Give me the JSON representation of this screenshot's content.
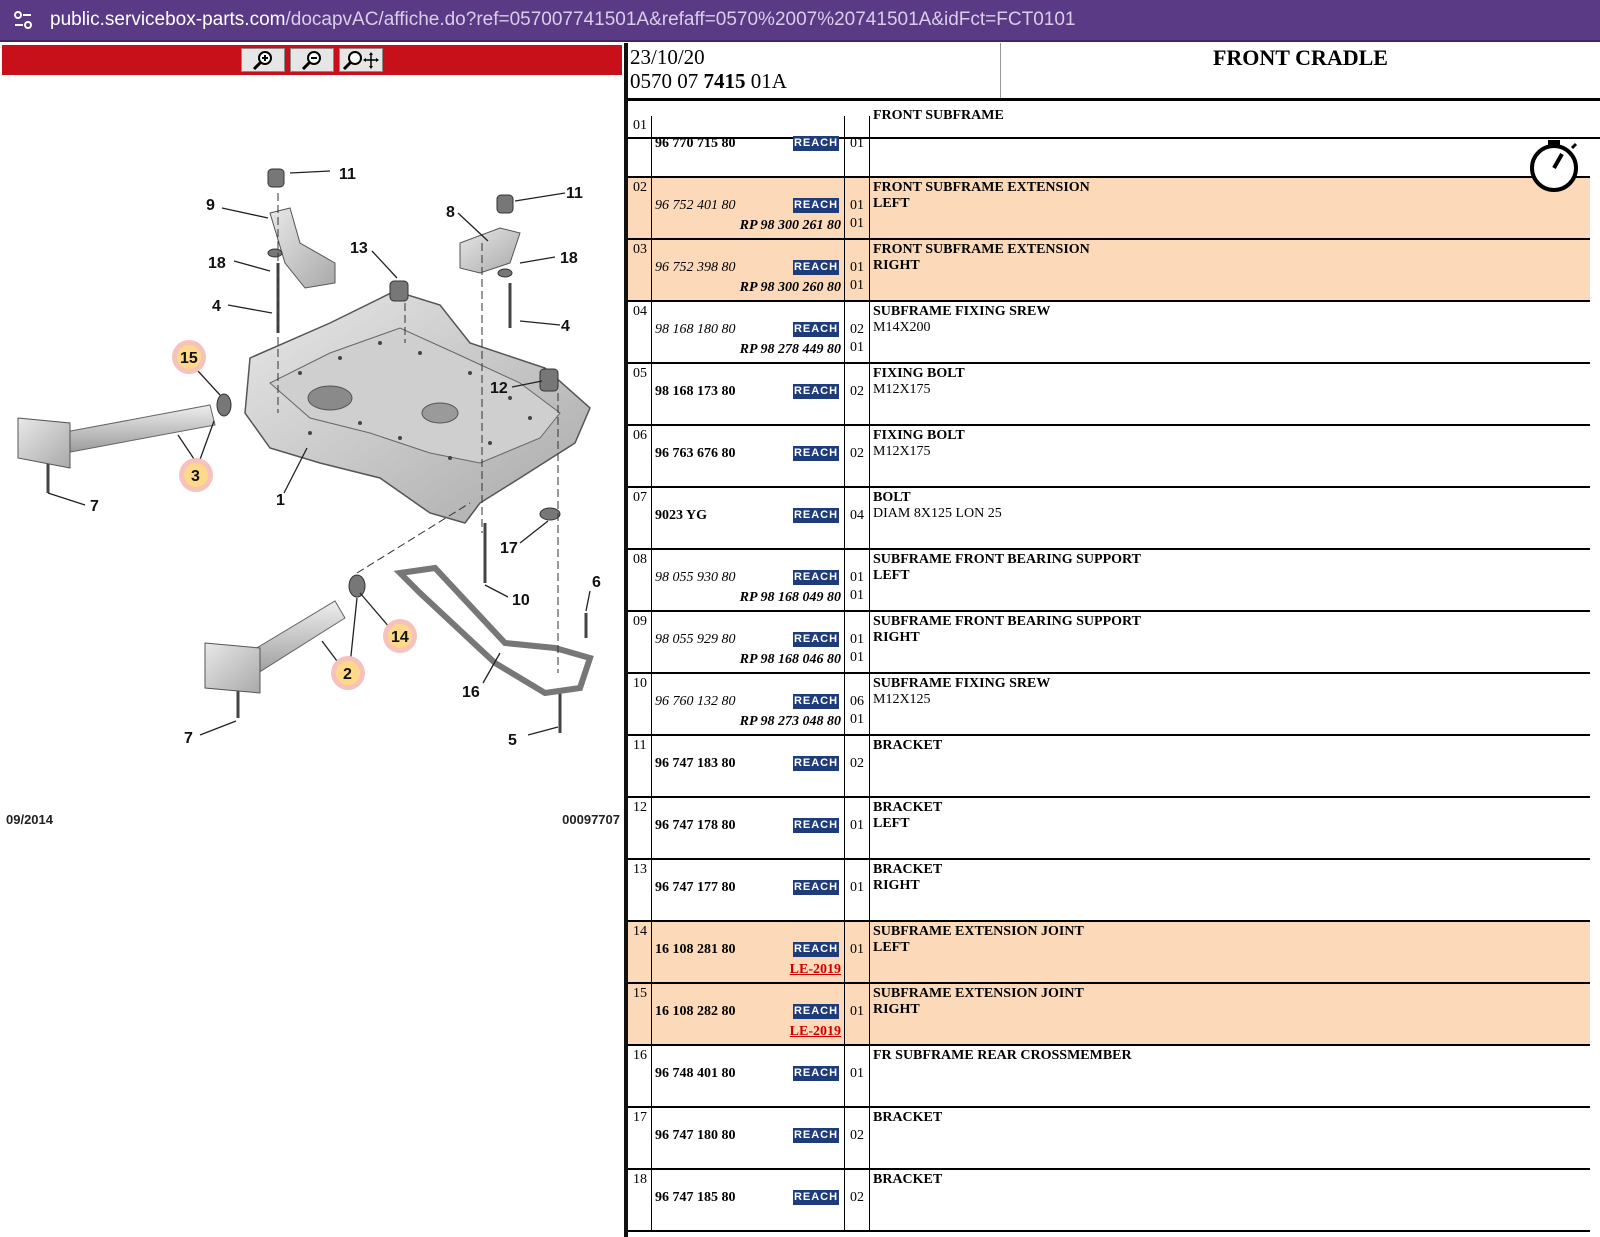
{
  "browser": {
    "url_host": "public.servicebox-parts.com",
    "url_path": "/docapvAC/affiche.do?ref=057007741501A&refaff=0570%2007%20741501A&idFct=FCT0101"
  },
  "viewer": {
    "tools": [
      {
        "name": "zoom-in-icon",
        "label": "zoom in"
      },
      {
        "name": "zoom-out-icon",
        "label": "zoom out"
      },
      {
        "name": "zoom-pan-icon",
        "label": "zoom pan"
      }
    ],
    "footer_date": "09/2014",
    "footer_ref": "00097707",
    "callouts": [
      "1",
      "2",
      "3",
      "4",
      "4",
      "5",
      "6",
      "7",
      "7",
      "8",
      "9",
      "10",
      "11",
      "11",
      "12",
      "13",
      "14",
      "15",
      "16",
      "17",
      "18",
      "18"
    ],
    "highlighted_callouts": [
      "15",
      "3",
      "14",
      "2"
    ]
  },
  "header": {
    "date": "23/10/20",
    "ref_prefix": "0570 07 ",
    "ref_bold": "7415",
    "ref_suffix": " 01A",
    "title": "FRONT CRADLE"
  },
  "reach_label": "REACH",
  "parts": [
    {
      "idx": "01",
      "ref": "96 770 715 80",
      "italic": false,
      "qty": "01",
      "qty2": "",
      "rp": "",
      "le": "",
      "desc": "FRONT SUBFRAME",
      "desc2": "",
      "highlight": false,
      "partial": true
    },
    {
      "idx": "02",
      "ref": "96 752 401 80",
      "italic": true,
      "qty": "01",
      "qty2": "01",
      "rp": "RP 98 300 261 80",
      "le": "",
      "desc": "FRONT SUBFRAME EXTENSION",
      "desc2": "LEFT",
      "desc2_bold": true,
      "highlight": true
    },
    {
      "idx": "03",
      "ref": "96 752 398 80",
      "italic": true,
      "qty": "01",
      "qty2": "01",
      "rp": "RP 98 300 260 80",
      "le": "",
      "desc": "FRONT SUBFRAME EXTENSION",
      "desc2": "RIGHT",
      "desc2_bold": true,
      "highlight": true
    },
    {
      "idx": "04",
      "ref": "98 168 180 80",
      "italic": true,
      "qty": "02",
      "qty2": "01",
      "rp": "RP 98 278 449 80",
      "le": "",
      "desc": "SUBFRAME FIXING SREW",
      "desc2": "M14X200",
      "desc2_bold": false,
      "highlight": false
    },
    {
      "idx": "05",
      "ref": "98 168 173 80",
      "italic": false,
      "qty": "02",
      "qty2": "",
      "rp": "",
      "le": "",
      "desc": "FIXING BOLT",
      "desc2": "M12X175",
      "desc2_bold": false,
      "highlight": false
    },
    {
      "idx": "06",
      "ref": "96 763 676 80",
      "italic": false,
      "qty": "02",
      "qty2": "",
      "rp": "",
      "le": "",
      "desc": "FIXING BOLT",
      "desc2": "M12X175",
      "desc2_bold": false,
      "highlight": false
    },
    {
      "idx": "07",
      "ref": "9023 YG",
      "italic": false,
      "qty": "04",
      "qty2": "",
      "rp": "",
      "le": "",
      "desc": "BOLT",
      "desc2": "DIAM 8X125 LON 25",
      "desc2_bold": false,
      "highlight": false
    },
    {
      "idx": "08",
      "ref": "98 055 930 80",
      "italic": true,
      "qty": "01",
      "qty2": "01",
      "rp": "RP 98 168 049 80",
      "le": "",
      "desc": "SUBFRAME FRONT BEARING SUPPORT",
      "desc2": "LEFT",
      "desc2_bold": true,
      "highlight": false
    },
    {
      "idx": "09",
      "ref": "98 055 929 80",
      "italic": true,
      "qty": "01",
      "qty2": "01",
      "rp": "RP 98 168 046 80",
      "le": "",
      "desc": "SUBFRAME FRONT BEARING SUPPORT",
      "desc2": "RIGHT",
      "desc2_bold": true,
      "highlight": false
    },
    {
      "idx": "10",
      "ref": "96 760 132 80",
      "italic": true,
      "qty": "06",
      "qty2": "01",
      "rp": "RP 98 273 048 80",
      "le": "",
      "desc": "SUBFRAME FIXING SREW",
      "desc2": "M12X125",
      "desc2_bold": false,
      "highlight": false
    },
    {
      "idx": "11",
      "ref": "96 747 183 80",
      "italic": false,
      "qty": "02",
      "qty2": "",
      "rp": "",
      "le": "",
      "desc": "BRACKET",
      "desc2": "",
      "desc2_bold": false,
      "highlight": false
    },
    {
      "idx": "12",
      "ref": "96 747 178 80",
      "italic": false,
      "qty": "01",
      "qty2": "",
      "rp": "",
      "le": "",
      "desc": "BRACKET",
      "desc2": "LEFT",
      "desc2_bold": true,
      "highlight": false
    },
    {
      "idx": "13",
      "ref": "96 747 177 80",
      "italic": false,
      "qty": "01",
      "qty2": "",
      "rp": "",
      "le": "",
      "desc": "BRACKET",
      "desc2": "RIGHT",
      "desc2_bold": true,
      "highlight": false
    },
    {
      "idx": "14",
      "ref": "16 108 281 80",
      "italic": false,
      "qty": "01",
      "qty2": "",
      "rp": "",
      "le": "LE-2019",
      "desc": "SUBFRAME EXTENSION JOINT",
      "desc2": "LEFT",
      "desc2_bold": true,
      "highlight": true
    },
    {
      "idx": "15",
      "ref": "16 108 282 80",
      "italic": false,
      "qty": "01",
      "qty2": "",
      "rp": "",
      "le": "LE-2019",
      "desc": "SUBFRAME EXTENSION JOINT",
      "desc2": "RIGHT",
      "desc2_bold": true,
      "highlight": true
    },
    {
      "idx": "16",
      "ref": "96 748 401 80",
      "italic": false,
      "qty": "01",
      "qty2": "",
      "rp": "",
      "le": "",
      "desc": "FR SUBFRAME REAR CROSSMEMBER",
      "desc2": "",
      "desc2_bold": false,
      "highlight": false
    },
    {
      "idx": "17",
      "ref": "96 747 180 80",
      "italic": false,
      "qty": "02",
      "qty2": "",
      "rp": "",
      "le": "",
      "desc": "BRACKET",
      "desc2": "",
      "desc2_bold": false,
      "highlight": false
    },
    {
      "idx": "18",
      "ref": "96 747 185 80",
      "italic": false,
      "qty": "02",
      "qty2": "",
      "rp": "",
      "le": "",
      "desc": "BRACKET",
      "desc2": "",
      "desc2_bold": false,
      "highlight": false
    }
  ],
  "colors": {
    "browser_bar": "#5a3a85",
    "toolbar_red": "#c8101a",
    "highlight_row": "#fcd9b8",
    "reach_badge": "#1e3c7a",
    "le_link": "#d00000",
    "callout_highlight": "#f6a9a0"
  }
}
